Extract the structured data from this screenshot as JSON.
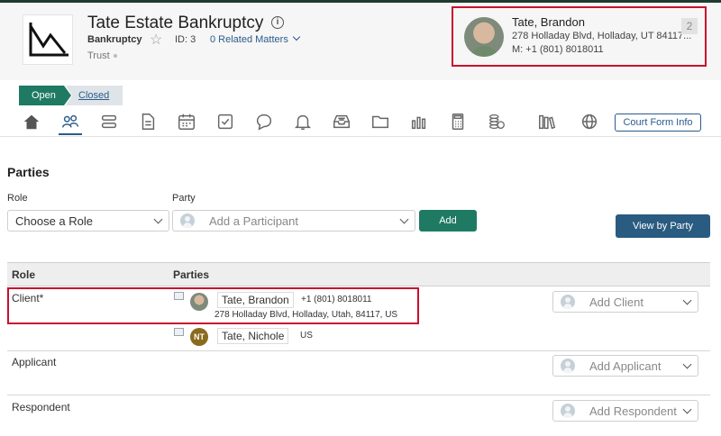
{
  "matter": {
    "title": "Tate Estate Bankruptcy",
    "type": "Bankruptcy",
    "id_label": "ID: 3",
    "related": "0 Related Matters",
    "subtype": "Trust"
  },
  "client_card": {
    "name": "Tate, Brandon",
    "address": "278 Holladay Blvd, Holladay, UT 84117...",
    "phone": "M: +1 (801) 8018011",
    "count": "2"
  },
  "status": {
    "open": "Open",
    "closed": "Closed"
  },
  "toolbar": {
    "icons": [
      "home-icon",
      "contacts-icon",
      "layers-icon",
      "document-icon",
      "calendar-icon",
      "checkbox-icon",
      "chat-icon",
      "bell-icon",
      "inbox-icon",
      "folder-icon",
      "chart-icon",
      "calculator-icon",
      "billing-icon",
      "library-icon",
      "globe-icon"
    ],
    "court_form": "Court Form Info"
  },
  "parties": {
    "title": "Parties",
    "role_label": "Role",
    "party_label": "Party",
    "role_placeholder": "Choose a Role",
    "party_placeholder": "Add a Participant",
    "add_button": "Add",
    "view_button": "View by Party",
    "columns": [
      "Role",
      "Parties"
    ],
    "rows": [
      {
        "role": "Client*",
        "add_label": "Add Client",
        "members": [
          {
            "name": "Tate, Brandon",
            "phone": "+1 (801) 8018011",
            "address": "278 Holladay Blvd, Holladay, Utah, 84117, US"
          },
          {
            "initials": "NT",
            "name": "Tate, Nichole",
            "country": "US"
          }
        ]
      },
      {
        "role": "Applicant",
        "add_label": "Add Applicant"
      },
      {
        "role": "Respondent",
        "add_label": "Add Respondent"
      }
    ]
  },
  "colors": {
    "accent_green": "#1f7a63",
    "accent_blue": "#2a5b80",
    "highlight_red": "#c8102e"
  }
}
